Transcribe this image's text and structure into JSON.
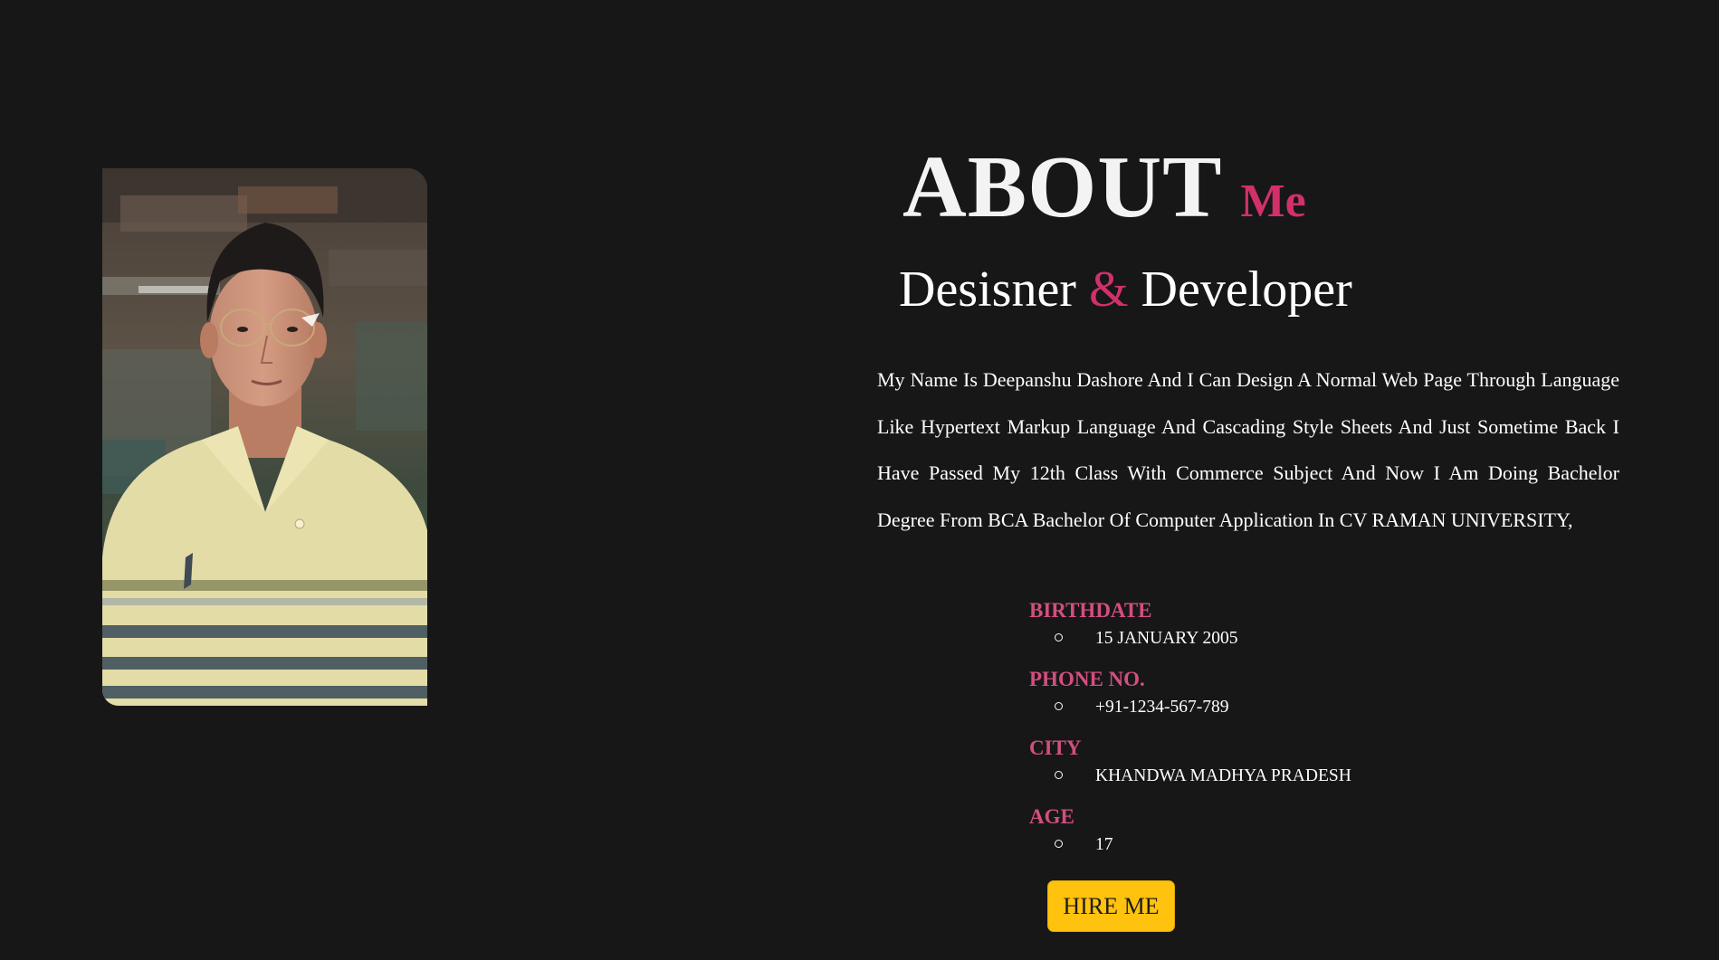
{
  "about": {
    "title": "ABOUT",
    "title_accent": "Me",
    "subtitle_part1": "Desisner",
    "subtitle_amp": "&",
    "subtitle_part2": "Developer"
  },
  "bio": "My Name Is Deepanshu Dashore And I Can Design A Normal Web Page Through Language Like Hypertext Markup Language And Cascading Style Sheets And Just Sometime Back I Have Passed My 12th Class With Commerce Subject And Now I Am Doing Bachelor Degree From BCA Bachelor Of Computer Application In CV RAMAN UNIVERSITY,",
  "details": [
    {
      "label": "BIRTHDATE",
      "value": "15 JANUARY 2005"
    },
    {
      "label": "PHONE NO.",
      "value": "+91-1234-567-789"
    },
    {
      "label": "CITY",
      "value": "KHANDWA MADHYA PRADESH"
    },
    {
      "label": "AGE",
      "value": "17"
    }
  ],
  "hire_button": "HIRE ME",
  "colors": {
    "background": "#171718",
    "accent": "#d1306b",
    "label": "#d24f7f",
    "button": "#ffc20e"
  }
}
